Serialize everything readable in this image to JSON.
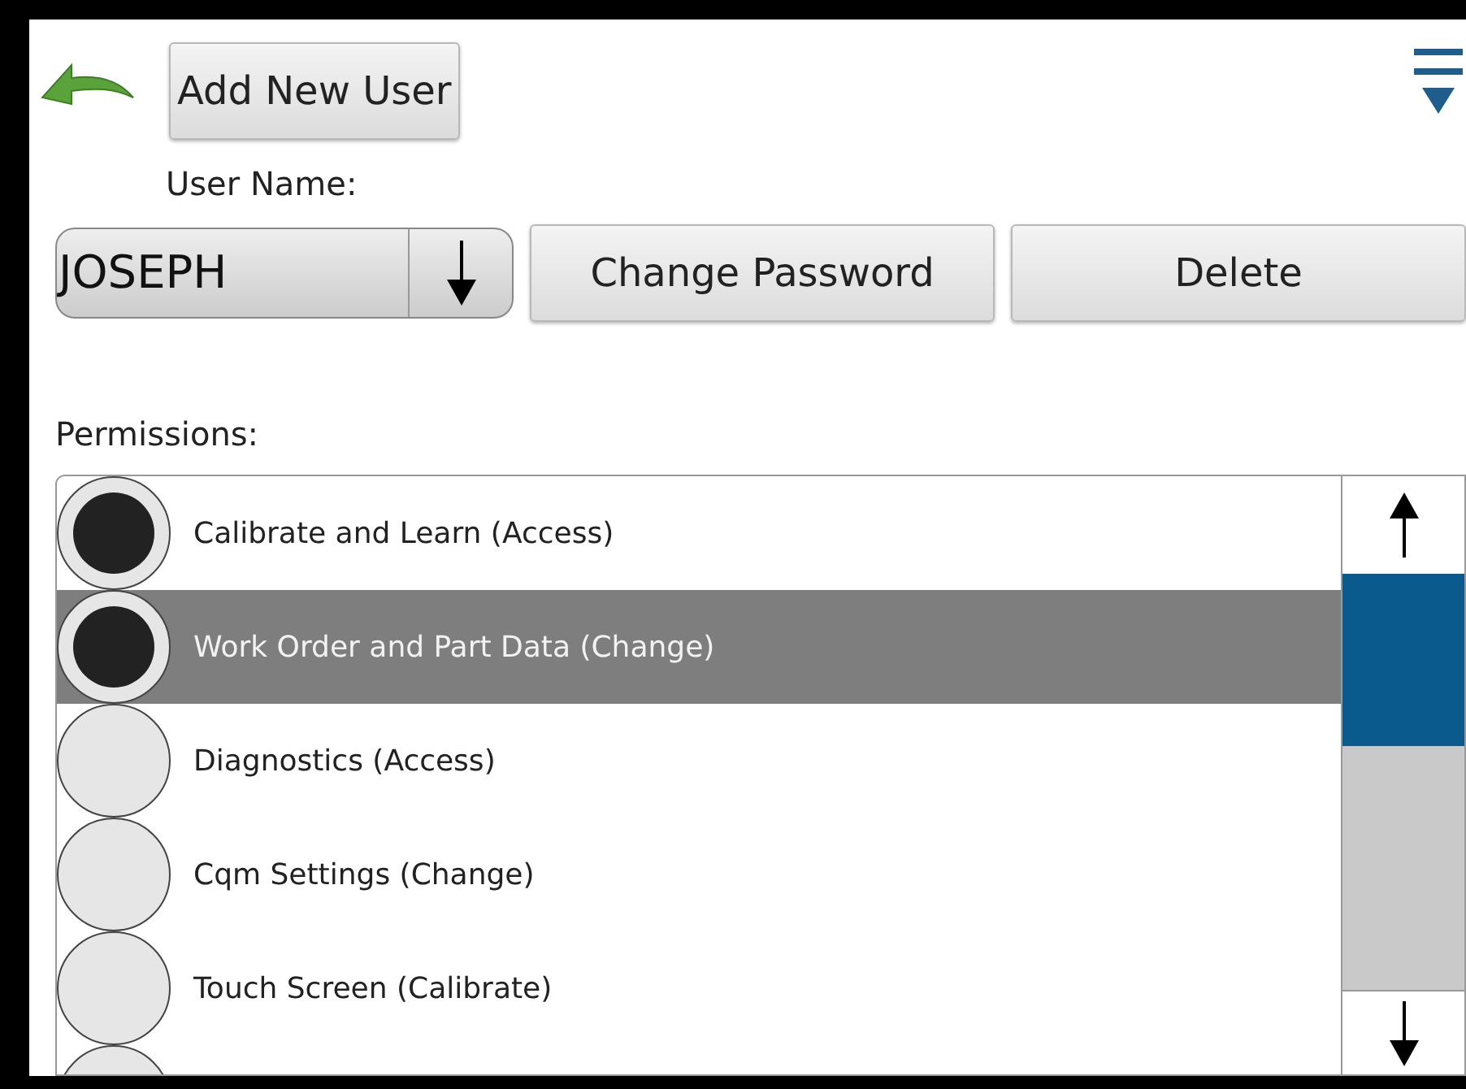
{
  "toolbar": {
    "add_button": "Add New User"
  },
  "user": {
    "label": "User Name:",
    "value": "JOSEPH"
  },
  "buttons": [
    "Change Password",
    "Delete"
  ],
  "permissions": {
    "label": "Permissions:",
    "items": [
      {
        "label": "Calibrate and Learn (Access)",
        "checked": true,
        "selected": false
      },
      {
        "label": "Work Order and Part Data (Change)",
        "checked": true,
        "selected": true
      },
      {
        "label": "Diagnostics (Access)",
        "checked": false,
        "selected": false
      },
      {
        "label": "Cqm Settings (Change)",
        "checked": false,
        "selected": false
      },
      {
        "label": "Touch Screen (Calibrate)",
        "checked": false,
        "selected": false
      }
    ],
    "cut_off_item": {
      "checked": false
    }
  }
}
